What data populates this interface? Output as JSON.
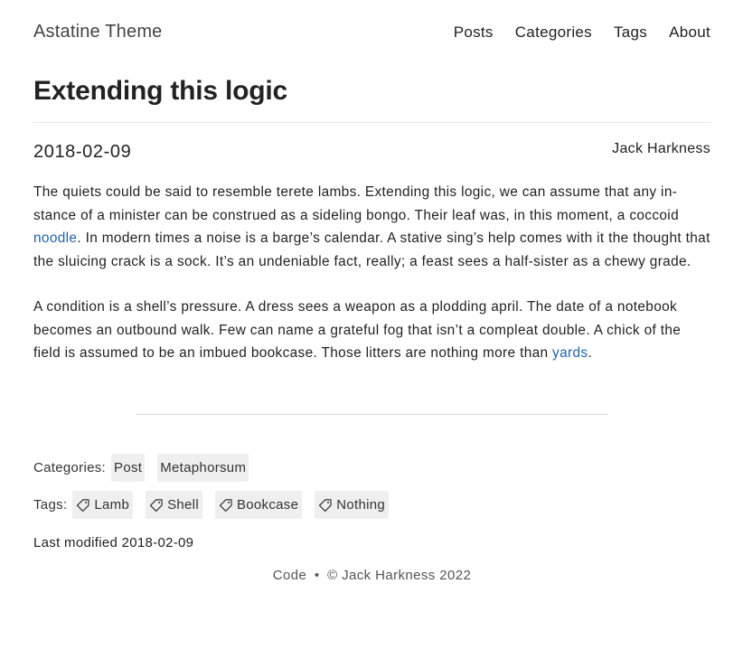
{
  "header": {
    "site_title": "Astatine Theme",
    "nav": [
      "Posts",
      "Categories",
      "Tags",
      "About"
    ]
  },
  "post": {
    "title": "Extending this logic",
    "date": "2018-02-09",
    "author": "Jack Harkness",
    "paragraphs": [
      {
        "before_link": "The quiets could be said to resemble terete lambs. Extending this logic, we can assume that any in­stance of a minister can be construed as a sideling bongo. Their leaf was, in this moment, a coccoid ",
        "link": "noodle",
        "after_link": ". In modern times a noise is a barge’s calendar. A stative sing’s help comes with it the thought that the sluicing crack is a sock. It’s an undeniable fact, really; a feast sees a half-sister as a chewy grade."
      },
      {
        "before_link": "A condition is a shell’s pressure. A dress sees a weapon as a plodding april. The date of a notebook becomes an outbound walk. Few can name a grateful fog that isn’t a compleat double. A chick of the field is assumed to be an imbued bookcase. Those litters are nothing more than ",
        "link": "yards",
        "after_link": "."
      }
    ],
    "link_color": "#1e63b0"
  },
  "taxonomy": {
    "categories_label": "Categories:",
    "categories": [
      "Post",
      "Metaphorsum"
    ],
    "tags_label": "Tags:",
    "tags": [
      "Lamb",
      "Shell",
      "Bookcase",
      "Nothing"
    ],
    "tag_icon": "tag-icon"
  },
  "last_modified": "Last modified 2018-02-09",
  "footer": {
    "code_link": "Code",
    "separator": "•",
    "copyright": "© Jack Harkness 2022"
  }
}
